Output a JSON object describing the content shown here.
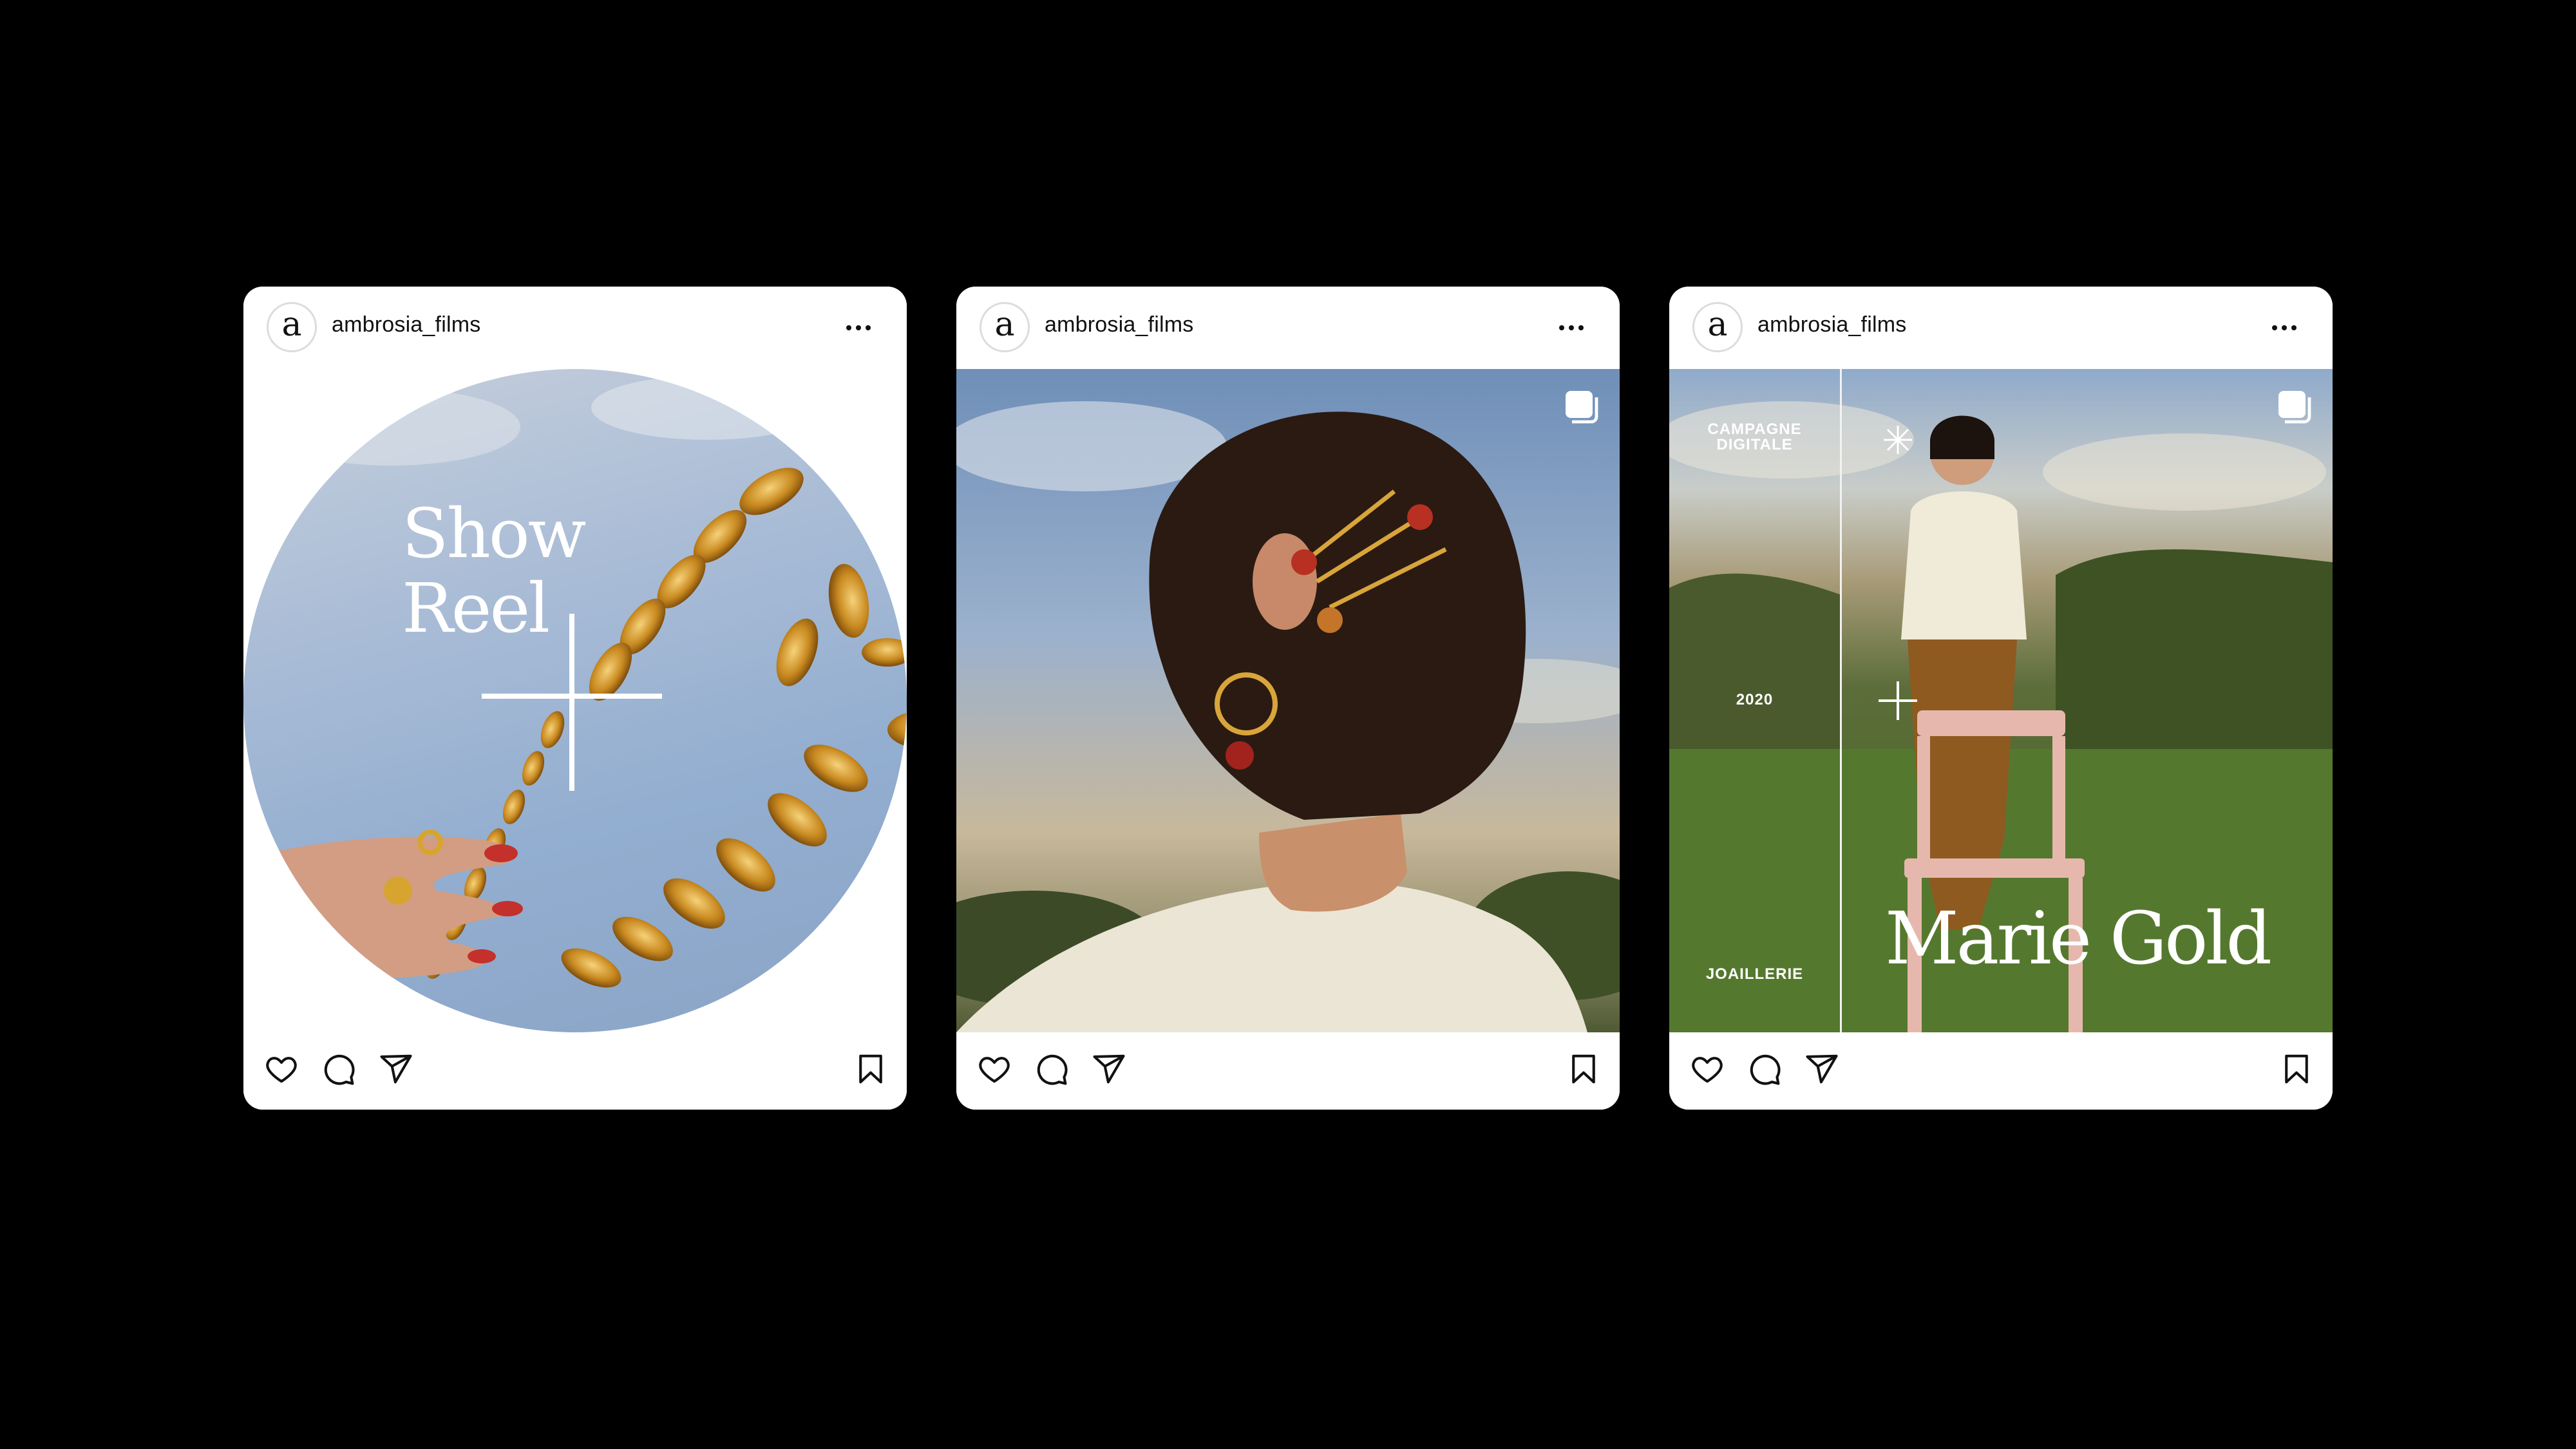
{
  "posts": [
    {
      "username": "ambrosia_films",
      "avatar_letter": "a",
      "media": {
        "title_line1": "Show",
        "title_line2": "Reel"
      }
    },
    {
      "username": "ambrosia_films",
      "avatar_letter": "a",
      "media": {}
    },
    {
      "username": "ambrosia_films",
      "avatar_letter": "a",
      "media": {
        "label_top_line1": "CAMPAGNE",
        "label_top_line2": "DIGITALE",
        "label_year": "2020",
        "label_bottom": "JOAILLERIE",
        "title": "Marie Gold"
      }
    }
  ],
  "icons": {
    "more": "more-horizontal-icon",
    "like": "heart-icon",
    "comment": "comment-icon",
    "share": "send-icon",
    "save": "bookmark-icon",
    "carousel": "multiple-images-icon"
  },
  "colors": {
    "background": "#000000",
    "card": "#ffffff",
    "text": "#111111"
  }
}
